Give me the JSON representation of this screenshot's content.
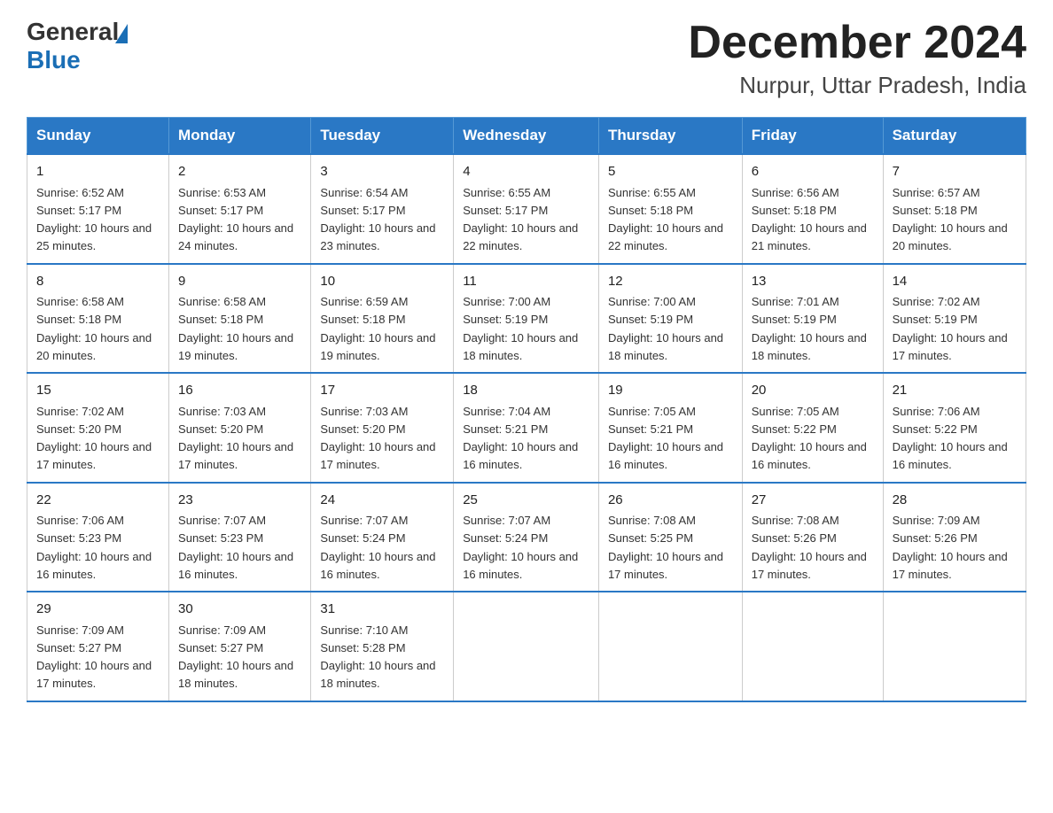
{
  "logo": {
    "general": "General",
    "blue": "Blue"
  },
  "title": "December 2024",
  "location": "Nurpur, Uttar Pradesh, India",
  "days_of_week": [
    "Sunday",
    "Monday",
    "Tuesday",
    "Wednesday",
    "Thursday",
    "Friday",
    "Saturday"
  ],
  "weeks": [
    [
      {
        "day": "1",
        "sunrise": "6:52 AM",
        "sunset": "5:17 PM",
        "daylight": "10 hours and 25 minutes."
      },
      {
        "day": "2",
        "sunrise": "6:53 AM",
        "sunset": "5:17 PM",
        "daylight": "10 hours and 24 minutes."
      },
      {
        "day": "3",
        "sunrise": "6:54 AM",
        "sunset": "5:17 PM",
        "daylight": "10 hours and 23 minutes."
      },
      {
        "day": "4",
        "sunrise": "6:55 AM",
        "sunset": "5:17 PM",
        "daylight": "10 hours and 22 minutes."
      },
      {
        "day": "5",
        "sunrise": "6:55 AM",
        "sunset": "5:18 PM",
        "daylight": "10 hours and 22 minutes."
      },
      {
        "day": "6",
        "sunrise": "6:56 AM",
        "sunset": "5:18 PM",
        "daylight": "10 hours and 21 minutes."
      },
      {
        "day": "7",
        "sunrise": "6:57 AM",
        "sunset": "5:18 PM",
        "daylight": "10 hours and 20 minutes."
      }
    ],
    [
      {
        "day": "8",
        "sunrise": "6:58 AM",
        "sunset": "5:18 PM",
        "daylight": "10 hours and 20 minutes."
      },
      {
        "day": "9",
        "sunrise": "6:58 AM",
        "sunset": "5:18 PM",
        "daylight": "10 hours and 19 minutes."
      },
      {
        "day": "10",
        "sunrise": "6:59 AM",
        "sunset": "5:18 PM",
        "daylight": "10 hours and 19 minutes."
      },
      {
        "day": "11",
        "sunrise": "7:00 AM",
        "sunset": "5:19 PM",
        "daylight": "10 hours and 18 minutes."
      },
      {
        "day": "12",
        "sunrise": "7:00 AM",
        "sunset": "5:19 PM",
        "daylight": "10 hours and 18 minutes."
      },
      {
        "day": "13",
        "sunrise": "7:01 AM",
        "sunset": "5:19 PM",
        "daylight": "10 hours and 18 minutes."
      },
      {
        "day": "14",
        "sunrise": "7:02 AM",
        "sunset": "5:19 PM",
        "daylight": "10 hours and 17 minutes."
      }
    ],
    [
      {
        "day": "15",
        "sunrise": "7:02 AM",
        "sunset": "5:20 PM",
        "daylight": "10 hours and 17 minutes."
      },
      {
        "day": "16",
        "sunrise": "7:03 AM",
        "sunset": "5:20 PM",
        "daylight": "10 hours and 17 minutes."
      },
      {
        "day": "17",
        "sunrise": "7:03 AM",
        "sunset": "5:20 PM",
        "daylight": "10 hours and 17 minutes."
      },
      {
        "day": "18",
        "sunrise": "7:04 AM",
        "sunset": "5:21 PM",
        "daylight": "10 hours and 16 minutes."
      },
      {
        "day": "19",
        "sunrise": "7:05 AM",
        "sunset": "5:21 PM",
        "daylight": "10 hours and 16 minutes."
      },
      {
        "day": "20",
        "sunrise": "7:05 AM",
        "sunset": "5:22 PM",
        "daylight": "10 hours and 16 minutes."
      },
      {
        "day": "21",
        "sunrise": "7:06 AM",
        "sunset": "5:22 PM",
        "daylight": "10 hours and 16 minutes."
      }
    ],
    [
      {
        "day": "22",
        "sunrise": "7:06 AM",
        "sunset": "5:23 PM",
        "daylight": "10 hours and 16 minutes."
      },
      {
        "day": "23",
        "sunrise": "7:07 AM",
        "sunset": "5:23 PM",
        "daylight": "10 hours and 16 minutes."
      },
      {
        "day": "24",
        "sunrise": "7:07 AM",
        "sunset": "5:24 PM",
        "daylight": "10 hours and 16 minutes."
      },
      {
        "day": "25",
        "sunrise": "7:07 AM",
        "sunset": "5:24 PM",
        "daylight": "10 hours and 16 minutes."
      },
      {
        "day": "26",
        "sunrise": "7:08 AM",
        "sunset": "5:25 PM",
        "daylight": "10 hours and 17 minutes."
      },
      {
        "day": "27",
        "sunrise": "7:08 AM",
        "sunset": "5:26 PM",
        "daylight": "10 hours and 17 minutes."
      },
      {
        "day": "28",
        "sunrise": "7:09 AM",
        "sunset": "5:26 PM",
        "daylight": "10 hours and 17 minutes."
      }
    ],
    [
      {
        "day": "29",
        "sunrise": "7:09 AM",
        "sunset": "5:27 PM",
        "daylight": "10 hours and 17 minutes."
      },
      {
        "day": "30",
        "sunrise": "7:09 AM",
        "sunset": "5:27 PM",
        "daylight": "10 hours and 18 minutes."
      },
      {
        "day": "31",
        "sunrise": "7:10 AM",
        "sunset": "5:28 PM",
        "daylight": "10 hours and 18 minutes."
      },
      null,
      null,
      null,
      null
    ]
  ]
}
